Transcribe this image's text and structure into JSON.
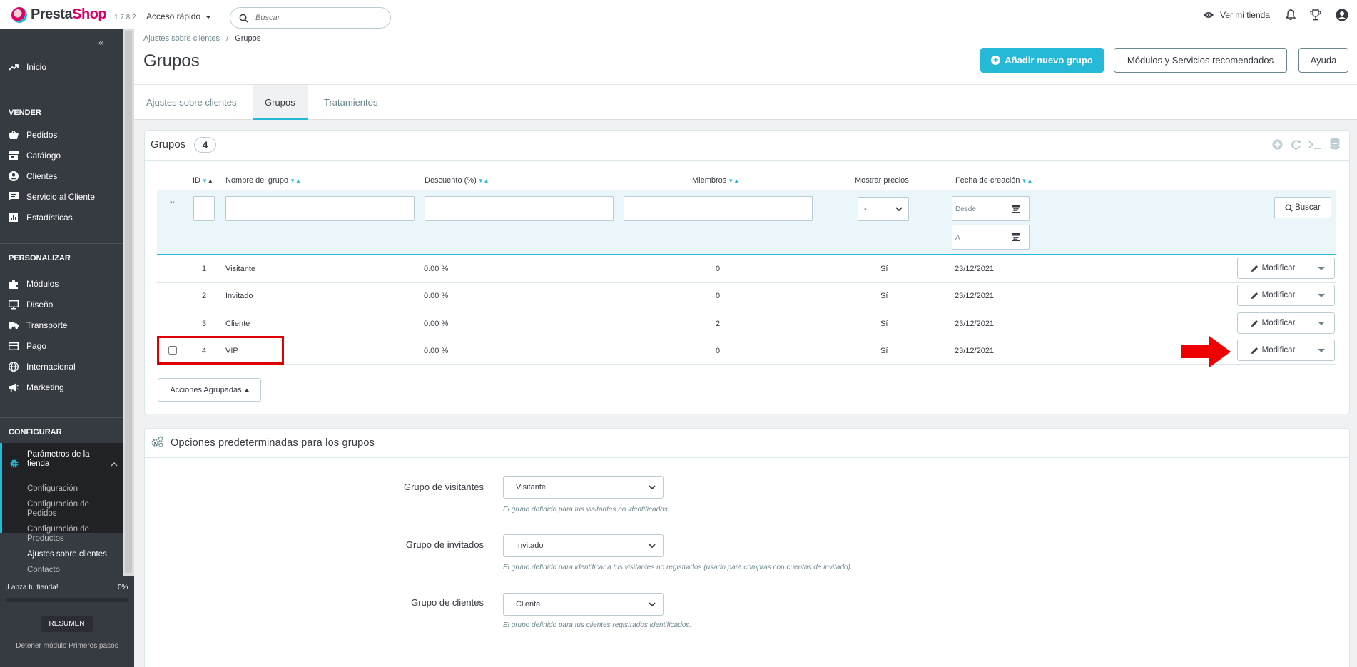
{
  "topbar": {
    "logo_part1": "Presta",
    "logo_part2": "Shop",
    "version": "1.7.8.2",
    "quick_access": "Acceso rápido",
    "search_placeholder": "Buscar",
    "view_shop": "Ver mi tienda"
  },
  "sidebar": {
    "dashboard": "Inicio",
    "sell_title": "VENDER",
    "sell_items": [
      "Pedidos",
      "Catálogo",
      "Clientes",
      "Servicio al Cliente",
      "Estadísticas"
    ],
    "improve_title": "PERSONALIZAR",
    "improve_items": [
      "Módulos",
      "Diseño",
      "Transporte",
      "Pago",
      "Internacional",
      "Marketing"
    ],
    "configure_title": "CONFIGURAR",
    "active_item_line1": "Parámetros de la",
    "active_item_line2": "tienda",
    "sub_items": [
      {
        "line1": "Configuración",
        "line2": ""
      },
      {
        "line1": "Configuración de",
        "line2": "Pedidos"
      },
      {
        "line1": "Configuración de",
        "line2": "Productos"
      },
      {
        "line1": "Ajustes sobre clientes",
        "line2": ""
      },
      {
        "line1": "Contacto",
        "line2": ""
      }
    ]
  },
  "onboarding": {
    "launch_label": "¡Lanza tu tienda!",
    "progress": "0%",
    "progress_fraction": 0,
    "summary_button": "RESUMEN",
    "stop_link": "Detener módulo Primeros pasos"
  },
  "header": {
    "breadcrumb_parent": "Ajustes sobre clientes",
    "breadcrumb_sep": "/",
    "breadcrumb_current": "Grupos",
    "title": "Grupos",
    "add_button": "Añadir nuevo grupo",
    "modules_button": "Módulos y Servicios recomendados",
    "help_button": "Ayuda"
  },
  "tabs": [
    "Ajustes sobre clientes",
    "Grupos",
    "Tratamientos"
  ],
  "groups_panel": {
    "title": "Grupos",
    "count": "4",
    "columns": {
      "id": "ID",
      "name": "Nombre del grupo",
      "discount": "Descuento (%)",
      "members": "Miembros",
      "show_prices": "Mostrar precios",
      "date": "Fecha de creación"
    },
    "filter": {
      "dash": "--",
      "select_value": "-",
      "date_from": "Desde",
      "date_to": "A",
      "search_button": "Buscar"
    },
    "rows": [
      {
        "id": "1",
        "name": "Visitante",
        "discount": "0.00 %",
        "members": "0",
        "show_prices": "Sí",
        "date": "23/12/2021"
      },
      {
        "id": "2",
        "name": "Invitado",
        "discount": "0.00 %",
        "members": "0",
        "show_prices": "Sí",
        "date": "23/12/2021"
      },
      {
        "id": "3",
        "name": "Cliente",
        "discount": "0.00 %",
        "members": "2",
        "show_prices": "Sí",
        "date": "23/12/2021"
      },
      {
        "id": "4",
        "name": "VIP",
        "discount": "0.00 %",
        "members": "0",
        "show_prices": "Sí",
        "date": "23/12/2021"
      }
    ],
    "edit_button": "Modificar",
    "bulk_button": "Acciones Agrupadas"
  },
  "options_panel": {
    "title": "Opciones predeterminadas para los grupos",
    "fields": [
      {
        "label": "Grupo de visitantes",
        "value": "Visitante",
        "help": "El grupo definido para tus visitantes no identificados."
      },
      {
        "label": "Grupo de invitados",
        "value": "Invitado",
        "help": "El grupo definido para identificar a tus visitantes no registrados (usado para compras con cuentas de invitado)."
      },
      {
        "label": "Grupo de clientes",
        "value": "Cliente",
        "help": "El grupo definido para tus clientes registrados identificados."
      }
    ]
  },
  "colors": {
    "accent": "#25b9d7",
    "brand": "#df0067",
    "sidebar": "#363a41",
    "annotation": "#e00000"
  }
}
